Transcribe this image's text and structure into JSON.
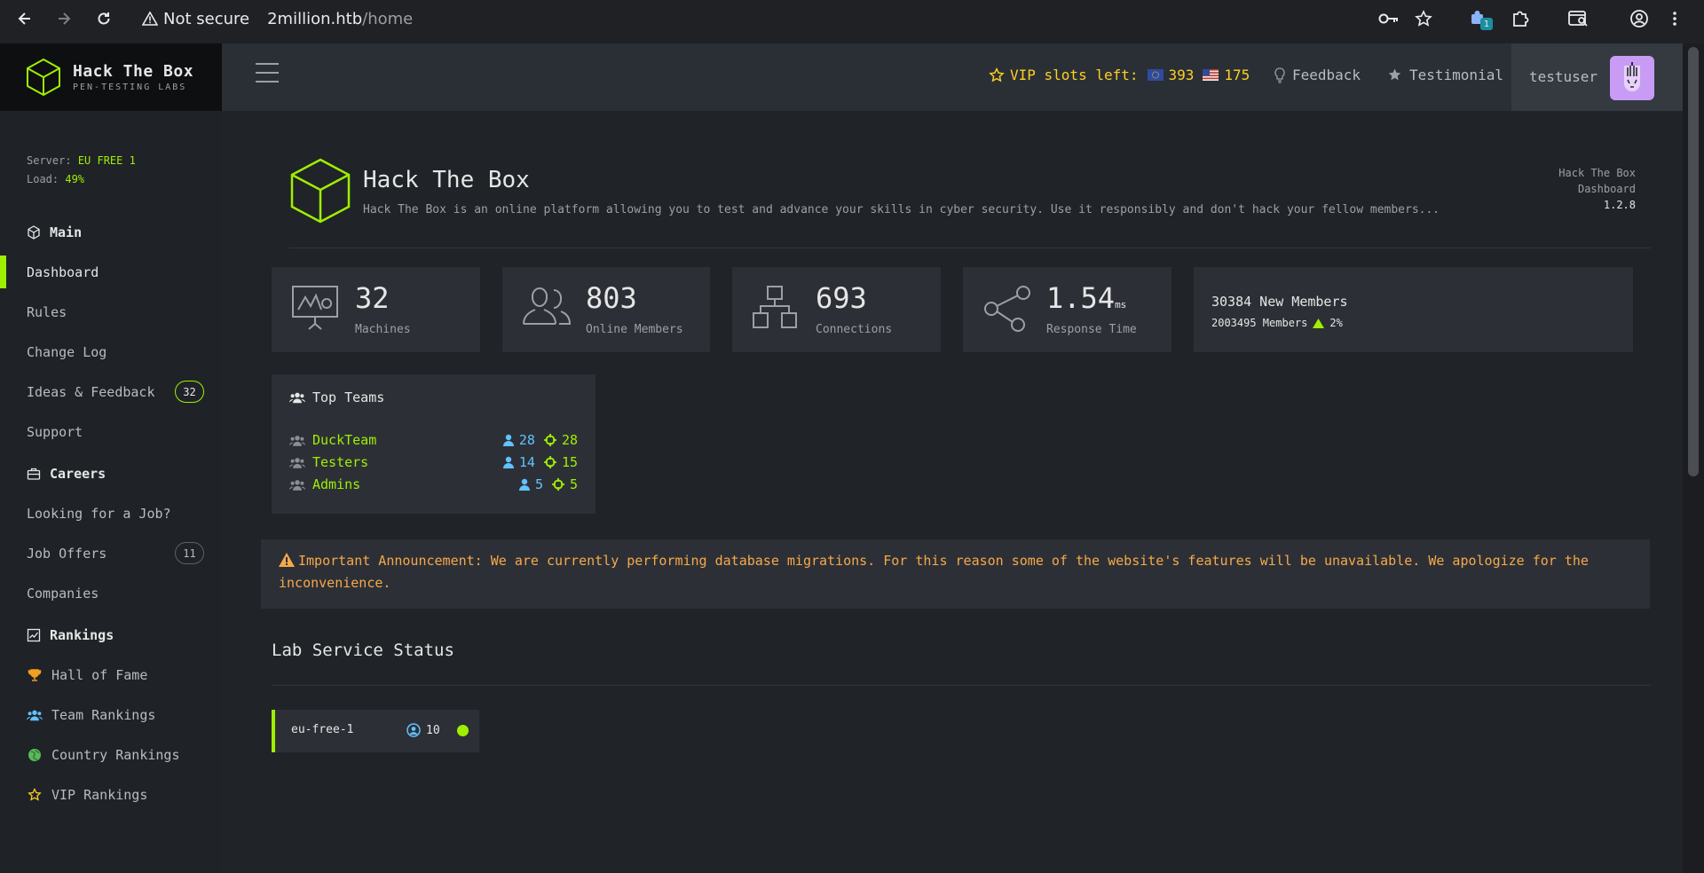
{
  "browser": {
    "security_label": "Not secure",
    "url_host": "2million.htb",
    "url_path": "/home",
    "extension_badge": "1"
  },
  "brand": {
    "name": "Hack The Box",
    "tagline": "PEN-TESTING LABS"
  },
  "server": {
    "label": "Server:",
    "name": "EU FREE 1",
    "load_label": "Load:",
    "load": "49%"
  },
  "sidebar": {
    "main_title": "Main",
    "main_items": [
      {
        "label": "Dashboard"
      },
      {
        "label": "Rules"
      },
      {
        "label": "Change Log"
      },
      {
        "label": "Ideas & Feedback",
        "badge": "32"
      },
      {
        "label": "Support"
      }
    ],
    "careers_title": "Careers",
    "careers_items": [
      {
        "label": "Looking for a Job?"
      },
      {
        "label": "Job Offers",
        "badge": "11"
      },
      {
        "label": "Companies"
      }
    ],
    "rankings_title": "Rankings",
    "rankings_items": [
      {
        "label": "Hall of Fame"
      },
      {
        "label": "Team Rankings"
      },
      {
        "label": "Country Rankings"
      },
      {
        "label": "VIP Rankings"
      }
    ]
  },
  "topbar": {
    "vip_label": "VIP slots left:",
    "vip_eu": "393",
    "vip_us": "175",
    "feedback": "Feedback",
    "testimonial": "Testimonial",
    "username": "testuser"
  },
  "header": {
    "title": "Hack The Box",
    "description": "Hack The Box is an online platform allowing you to test and advance your skills in cyber security. Use it responsibly and don't hack your fellow members...",
    "right_line1": "Hack The Box",
    "right_line2": "Dashboard",
    "version": "1.2.8"
  },
  "stats": [
    {
      "value": "32",
      "label": "Machines"
    },
    {
      "value": "803",
      "label": "Online Members"
    },
    {
      "value": "693",
      "label": "Connections"
    },
    {
      "value": "1.54",
      "unit": "ms",
      "label": "Response Time"
    }
  ],
  "members": {
    "new_line": "30384 New Members",
    "total_line": "2003495 Members",
    "growth": "2%"
  },
  "top_teams": {
    "title": "Top Teams",
    "teams": [
      {
        "name": "DuckTeam",
        "users": "28",
        "owns": "28"
      },
      {
        "name": "Testers",
        "users": "14",
        "owns": "15"
      },
      {
        "name": "Admins",
        "users": "5",
        "owns": "5"
      }
    ]
  },
  "announcement": "Important Announcement: We are currently performing database migrations. For this reason some of the website's features will be unavailable. We apologize for the inconvenience.",
  "lab_status": {
    "title": "Lab Service Status",
    "servers": [
      {
        "name": "eu-free-1",
        "users": "10",
        "status": "online"
      }
    ]
  },
  "colors": {
    "accent": "#9fef00",
    "vip": "#ffd021",
    "warning": "#f7a84a",
    "info": "#62c1ff"
  }
}
